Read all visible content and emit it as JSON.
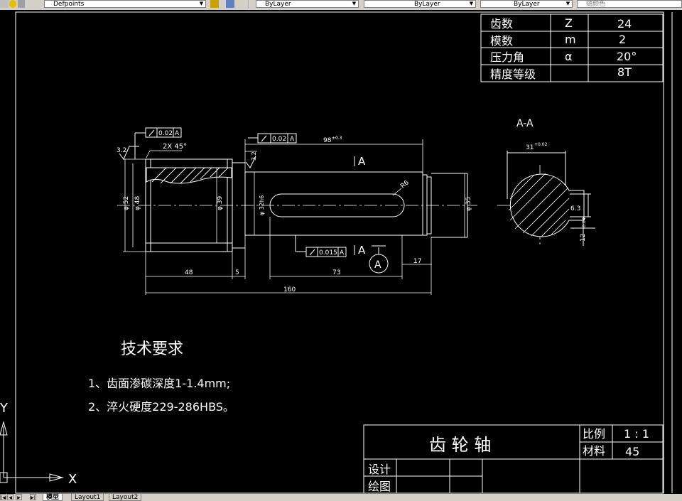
{
  "toolbar": {
    "layer_name": "Defpoints",
    "color": "ByLayer",
    "linetype": "ByLayer",
    "lineweight": "ByLayer",
    "plot_style": "随颜色"
  },
  "gear_table": {
    "rows": [
      {
        "name": "齿数",
        "symbol": "Z",
        "value": "24"
      },
      {
        "name": "模数",
        "symbol": "m",
        "value": "2"
      },
      {
        "name": "压力角",
        "symbol": "α",
        "value": "20°"
      },
      {
        "name": "精度等级",
        "symbol": "",
        "value": "8T"
      }
    ]
  },
  "drawing": {
    "section_title": "A-A",
    "gtol_1": "0.02",
    "gtol_2": "0.02",
    "gtol_3": "0.015",
    "chamfer": "2X 45°",
    "roughness_1": "3.2",
    "roughness_2": "3.2",
    "dim_length_98": "98",
    "dim_tol_98": "±0.3",
    "section_mark_top": "A",
    "section_mark_bottom": "A",
    "datum_label": "A",
    "radius_label": "R6",
    "dia_52": "φ 52",
    "dia_48": "φ 48",
    "dia_39": "φ 39",
    "dia_32": "φ 32h6",
    "dia_35": "φ 35",
    "dim_48": "48",
    "dim_5": "5",
    "dim_73": "73",
    "dim_17": "17",
    "dim_160": "160",
    "section_width": "31",
    "section_width_tol": "+0.02",
    "section_depth": "6.3",
    "section_key": "12",
    "section_key_tol": "-0.04"
  },
  "notes": {
    "title": "技术要求",
    "items": [
      "1、齿面渗碳深度1-1.4mm;",
      "2、淬火硬度229-286HBS。"
    ]
  },
  "title_block": {
    "part_name": "齿 轮 轴",
    "scale_label": "比例",
    "scale_value": "1 : 1",
    "material_label": "材料",
    "material_value": "45",
    "designer_label": "设计",
    "drafter_label": "绘图"
  },
  "ucs": {
    "x_label": "X",
    "y_label": "Y"
  },
  "tabs": [
    "模型",
    "Layout1",
    "Layout2"
  ],
  "colors": {
    "line": "#ffffff",
    "background": "#000000"
  }
}
